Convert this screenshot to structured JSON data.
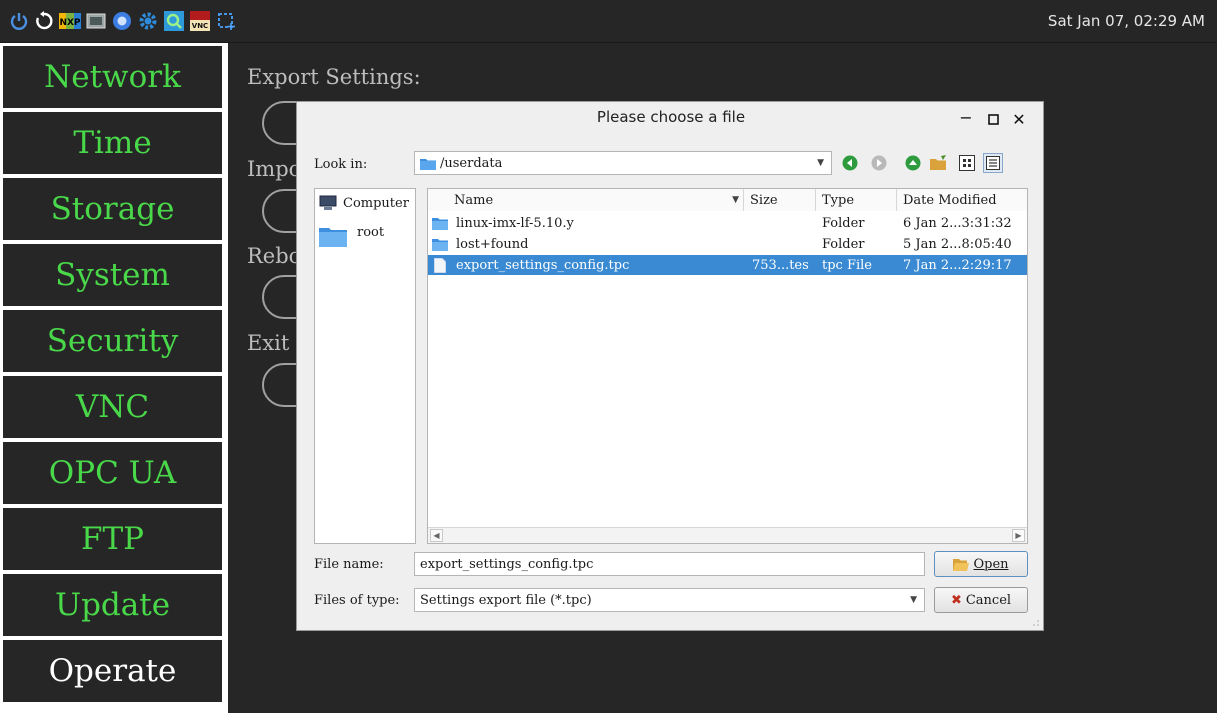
{
  "taskbar": {
    "clock": "Sat Jan 07, 02:29 AM",
    "icons": [
      "power-icon",
      "restart-icon",
      "nxp-icon",
      "keyboard-icon",
      "browser-icon",
      "settings-gear-icon",
      "search-app-icon",
      "tightvnc-icon",
      "screenshot-select-icon"
    ],
    "accent": "#49d849"
  },
  "sidebar": {
    "items": [
      {
        "label": "Network"
      },
      {
        "label": "Time"
      },
      {
        "label": "Storage"
      },
      {
        "label": "System"
      },
      {
        "label": "Security"
      },
      {
        "label": "VNC"
      },
      {
        "label": "OPC UA"
      },
      {
        "label": "FTP"
      },
      {
        "label": "Update"
      },
      {
        "label": "Operate"
      }
    ],
    "active": "Operate"
  },
  "main": {
    "sections": [
      {
        "label": "Export Settings:"
      },
      {
        "label": "Impo"
      },
      {
        "label": "Rebo"
      },
      {
        "label": "Exit"
      }
    ]
  },
  "dialog": {
    "title": "Please choose a file",
    "look_in_label": "Look in:",
    "look_in_value": "/userdata",
    "places": [
      {
        "label": "Computer",
        "icon": "computer-icon"
      },
      {
        "label": "root",
        "icon": "folder-icon"
      }
    ],
    "columns": {
      "name": "Name",
      "size": "Size",
      "type": "Type",
      "modified": "Date Modified"
    },
    "files": [
      {
        "name": "linux-imx-lf-5.10.y",
        "size": "",
        "type": "Folder",
        "modified": "6 Jan 2...3:31:32",
        "icon": "folder-icon",
        "selected": false
      },
      {
        "name": "lost+found",
        "size": "",
        "type": "Folder",
        "modified": "5 Jan 2...8:05:40",
        "icon": "folder-icon",
        "selected": false
      },
      {
        "name": "export_settings_config.tpc",
        "size": "753...tes",
        "type": "tpc File",
        "modified": "7 Jan 2...2:29:17",
        "icon": "file-icon",
        "selected": true
      }
    ],
    "file_name_label": "File name:",
    "file_name_value": "export_settings_config.tpc",
    "file_type_label": "Files of type:",
    "file_type_value": "Settings export file (*.tpc)",
    "open_label": "Open",
    "cancel_label": "Cancel",
    "selection_color": "#3a8ad3"
  }
}
